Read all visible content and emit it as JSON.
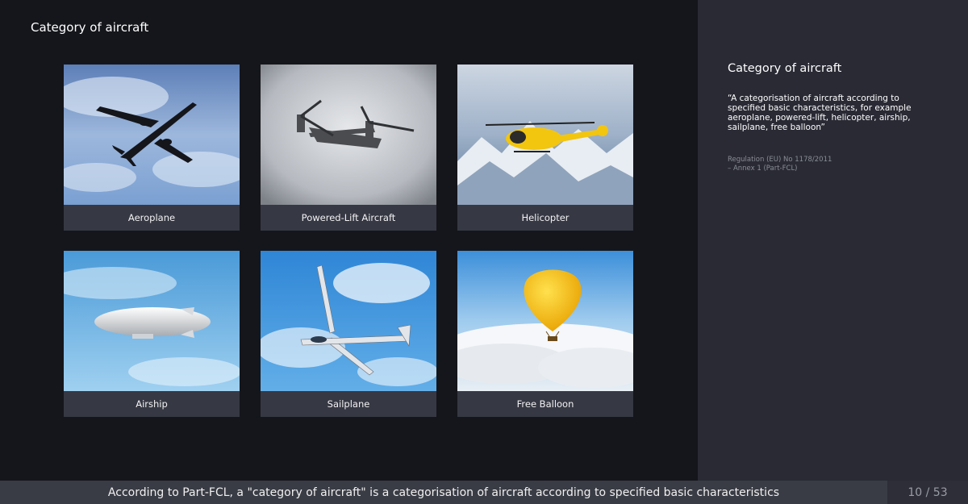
{
  "slide": {
    "title": "Category of aircraft"
  },
  "cards": [
    {
      "label": "Aeroplane",
      "image": "aeroplane-photo"
    },
    {
      "label": "Powered-Lift Aircraft",
      "image": "tiltrotor-photo"
    },
    {
      "label": "Helicopter",
      "image": "helicopter-photo"
    },
    {
      "label": "Airship",
      "image": "airship-photo"
    },
    {
      "label": "Sailplane",
      "image": "sailplane-photo"
    },
    {
      "label": "Free Balloon",
      "image": "balloon-photo"
    }
  ],
  "sidebar": {
    "title": "Category of aircraft",
    "quote": "“A categorisation of aircraft according to specified basic characteristics, for example aeroplane, powered-lift, helicopter, airship, sailplane, free balloon”",
    "source_line1": "Regulation (EU) No 1178/2011",
    "source_line2": "– Annex 1 (Part-FCL)"
  },
  "footer": {
    "subtitle": "According to Part-FCL, a \"category of aircraft\" is a categorisation of aircraft according to specified basic characteristics",
    "page": "10 / 53"
  },
  "colors": {
    "background": "#15161b",
    "sidebar": "#292a34",
    "caption_bar": "#363843",
    "subtitle_bar": "#3a3c45"
  }
}
